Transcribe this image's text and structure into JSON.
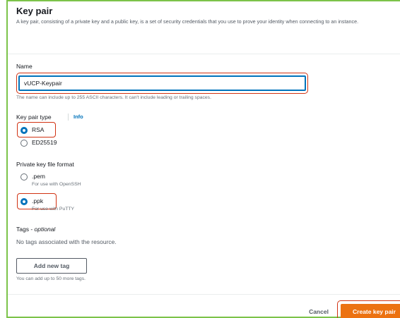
{
  "header": {
    "title": "Key pair",
    "description": "A key pair, consisting of a private key and a public key, is a set of security credentials that you use to prove your identity when connecting to an instance."
  },
  "name": {
    "label": "Name",
    "value": "vUCP-Keypair",
    "hint": "The name can include up to 255 ASCII characters. It can't include leading or trailing spaces."
  },
  "key_type": {
    "label": "Key pair type",
    "info": "Info",
    "options": [
      {
        "label": "RSA",
        "selected": true
      },
      {
        "label": "ED25519",
        "selected": false
      }
    ]
  },
  "file_format": {
    "label": "Private key file format",
    "options": [
      {
        "label": ".pem",
        "sub": "For use with OpenSSH",
        "selected": false
      },
      {
        "label": ".ppk",
        "sub": "For use with PuTTY",
        "selected": true
      }
    ]
  },
  "tags": {
    "label": "Tags",
    "optional": "optional",
    "empty_text": "No tags associated with the resource.",
    "add_button": "Add new tag",
    "limit_hint": "You can add up to 50 more tags."
  },
  "footer": {
    "cancel": "Cancel",
    "create": "Create key pair"
  },
  "colors": {
    "accent": "#0073bb",
    "primary_button": "#ec7211",
    "highlight": "#d13212",
    "frame": "#7cc34a"
  }
}
